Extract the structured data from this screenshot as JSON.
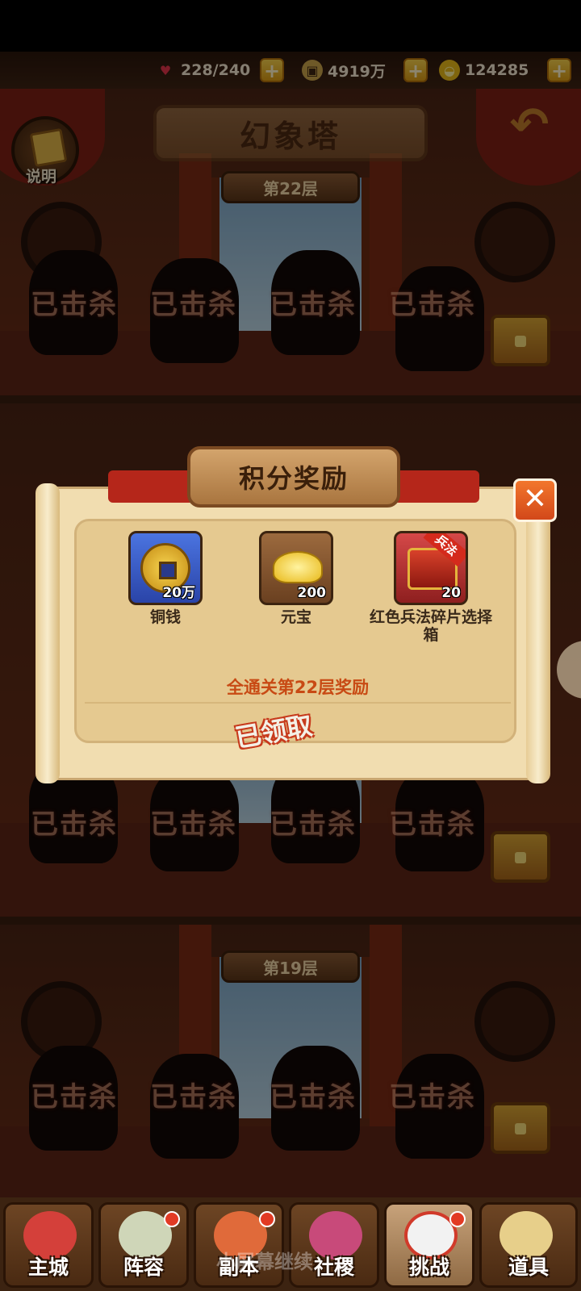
{
  "resources": {
    "stamina": "228/240",
    "copper": "4919万",
    "gold": "124285"
  },
  "header": {
    "title": "幻象塔",
    "help_label": "说明"
  },
  "floors": [
    {
      "label": "第22层"
    },
    {
      "label": "第19层"
    }
  ],
  "killed_label": "已击杀",
  "dialog": {
    "title": "积分奖励",
    "close_label": "✕",
    "rewards": [
      {
        "name": "铜钱",
        "qty": "20万",
        "icon": "copper-coin-icon"
      },
      {
        "name": "元宝",
        "qty": "200",
        "icon": "gold-ingot-icon"
      },
      {
        "name": "红色兵法碎片选择箱",
        "qty": "20",
        "icon": "red-chest-icon",
        "tag": "兵法"
      }
    ],
    "clear_text": "全通关第22层奖励",
    "claimed_text": "已领取"
  },
  "nav": {
    "tabs": [
      {
        "label": "主城"
      },
      {
        "label": "阵容"
      },
      {
        "label": "副本"
      },
      {
        "label": "社稷"
      },
      {
        "label": "挑战"
      },
      {
        "label": "道具"
      }
    ],
    "overlay_text": "小屏幕继续"
  },
  "colors": {
    "accent_red": "#c84a14",
    "close_orange": "#e85c22",
    "parchment": "#f1ddb0"
  }
}
